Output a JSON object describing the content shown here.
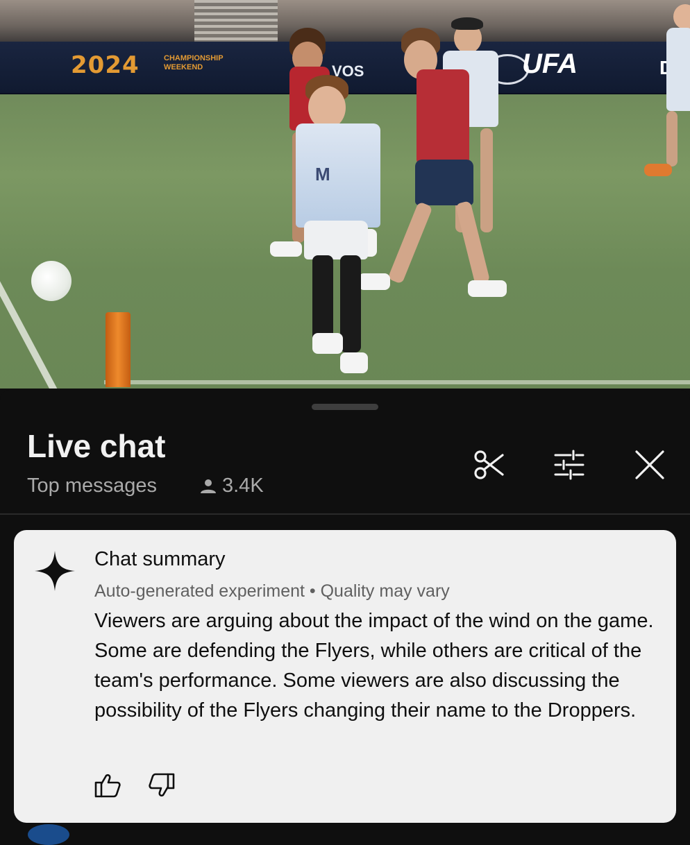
{
  "video": {
    "banner_year": "2024",
    "banner_event": "CHAMPIONSHIP\nWEEKEND",
    "banner_sponsor": "VOS",
    "banner_league": "UFA",
    "banner_right": "D",
    "jersey_letter": "M"
  },
  "live_chat": {
    "title": "Live chat",
    "filter_label": "Top messages",
    "viewer_count": "3.4K",
    "icons": [
      "scissors-icon",
      "sliders-icon",
      "close-icon"
    ]
  },
  "summary": {
    "title": "Chat summary",
    "meta": "Auto-generated experiment • Quality may vary",
    "body": "Viewers are arguing about the impact of the wind on the game. Some are defending the Flyers, while others are critical of the team's performance. Some viewers are also discussing the possibility of the Flyers changing their name to the Droppers.",
    "feedback": [
      "thumbs-up-icon",
      "thumbs-down-icon"
    ]
  },
  "colors": {
    "panel_bg": "#0f0f0f",
    "card_bg": "#f0f0f0",
    "secondary_text": "#aaaaaa"
  }
}
